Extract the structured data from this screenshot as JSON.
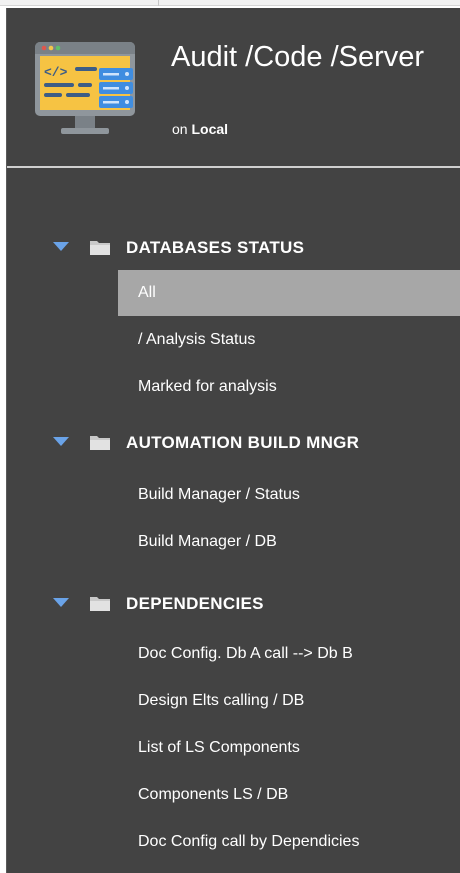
{
  "header": {
    "title": "Audit /Code /Server",
    "subtitle_prefix": "on",
    "server": "Local"
  },
  "colors": {
    "panel_bg": "#434343",
    "active_item_bg": "#a7a7a7",
    "caret": "#6aa3e8",
    "text": "#ffffff"
  },
  "nav": {
    "sections": [
      {
        "label": "DATABASES STATUS",
        "expanded": true,
        "icon": "folder-icon",
        "items": [
          {
            "label": "All",
            "active": true
          },
          {
            "label": "/ Analysis Status",
            "active": false
          },
          {
            "label": "Marked for analysis",
            "active": false
          }
        ]
      },
      {
        "label": "AUTOMATION BUILD MNGR",
        "expanded": true,
        "icon": "folder-icon",
        "items": [
          {
            "label": "Build Manager / Status",
            "active": false
          },
          {
            "label": "Build Manager / DB",
            "active": false
          }
        ]
      },
      {
        "label": "DEPENDENCIES",
        "expanded": true,
        "icon": "folder-icon",
        "items": [
          {
            "label": "Doc Config. Db A call --> Db B",
            "active": false
          },
          {
            "label": "Design Elts calling / DB",
            "active": false
          },
          {
            "label": "List of LS Components",
            "active": false
          },
          {
            "label": "Components LS / DB",
            "active": false
          },
          {
            "label": "Doc Config call by Dependicies",
            "active": false
          }
        ]
      }
    ]
  }
}
